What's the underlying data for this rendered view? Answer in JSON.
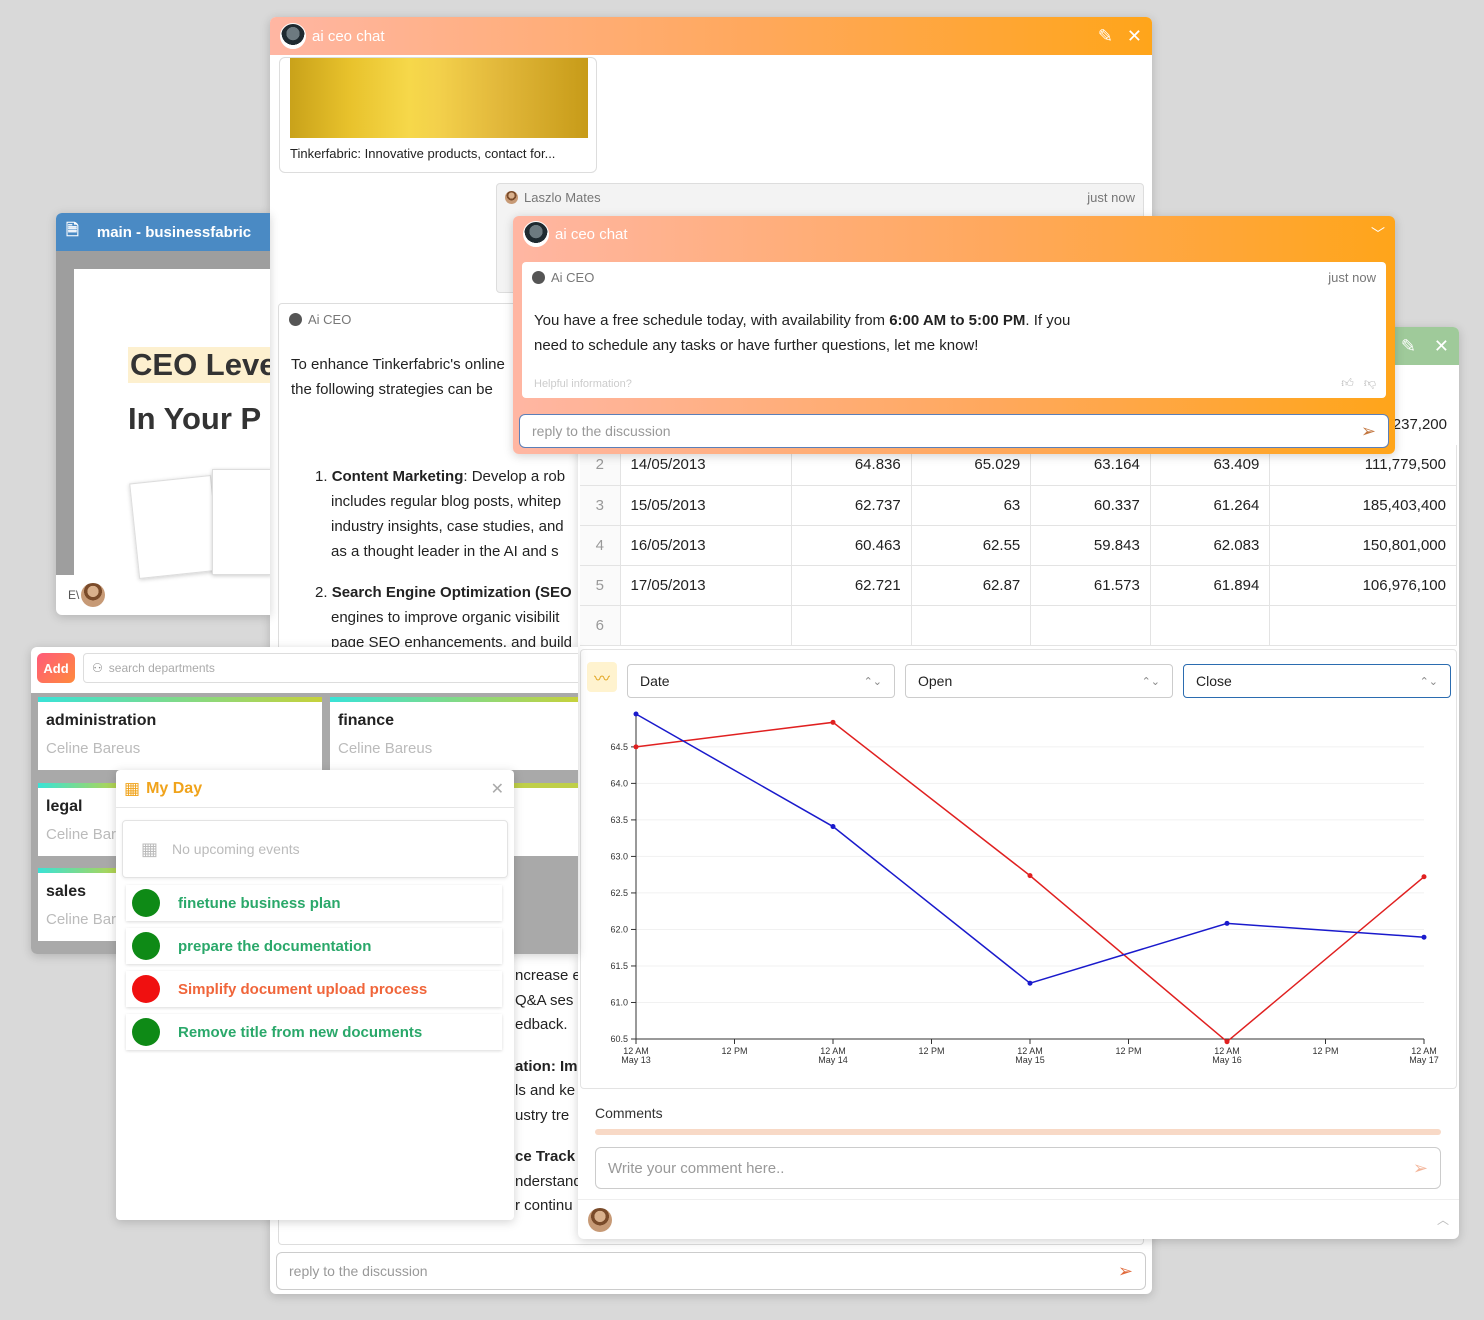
{
  "back_chat": {
    "title": "ai ceo chat",
    "link_preview": "Tinkerfabric: Innovative products, contact for...",
    "user_msg": {
      "author": "Laszlo Mates",
      "time": "just now"
    },
    "ai_msg": {
      "author": "Ai CEO",
      "intro": "To enhance Tinkerfabric's online",
      "intro2": "the following strategies can be",
      "item1_title": "Content Marketing",
      "item1_lines": [
        ": Develop a rob",
        "includes regular blog posts, whitep",
        "industry insights, case studies, and",
        "as a thought leader in the AI and s"
      ],
      "item2_title": "Search Engine Optimization (SEO",
      "item2_lines": [
        "engines to improve organic visibilit",
        "page SEO enhancements, and build"
      ],
      "frag": [
        "ncrease e",
        "Q&A ses",
        "edback.",
        "ation: Im",
        "ls and ke",
        "ustry tre",
        "ce Track",
        "nderstand",
        "r continu"
      ]
    },
    "reply_placeholder": "reply to the discussion"
  },
  "doc_window": {
    "title": "main - businessfabric",
    "heading1": "CEO Leve",
    "heading2": "In Your P",
    "footer_initials": "E\\"
  },
  "front_chat": {
    "title": "ai ceo chat",
    "msg": {
      "author": "Ai CEO",
      "time": "just now",
      "text_a": "You have a free schedule today, with availability from ",
      "text_bold": "6:00 AM to 5:00 PM",
      "text_b": ". If you",
      "text_c": "need to schedule any tasks or have further questions, let me know!",
      "helpful": "Helpful information?"
    },
    "reply_placeholder": "reply to the discussion"
  },
  "data_window": {
    "partial_value": "237,200",
    "rows": [
      {
        "n": "2",
        "date": "14/05/2013",
        "c1": "64.836",
        "c2": "65.029",
        "c3": "63.164",
        "c4": "63.409",
        "c5": "111,779,500"
      },
      {
        "n": "3",
        "date": "15/05/2013",
        "c1": "62.737",
        "c2": "63",
        "c3": "60.337",
        "c4": "61.264",
        "c5": "185,403,400"
      },
      {
        "n": "4",
        "date": "16/05/2013",
        "c1": "60.463",
        "c2": "62.55",
        "c3": "59.843",
        "c4": "62.083",
        "c5": "150,801,000"
      },
      {
        "n": "5",
        "date": "17/05/2013",
        "c1": "62.721",
        "c2": "62.87",
        "c3": "61.573",
        "c4": "61.894",
        "c5": "106,976,100"
      },
      {
        "n": "6",
        "date": "",
        "c1": "",
        "c2": "",
        "c3": "",
        "c4": "",
        "c5": ""
      }
    ],
    "selects": {
      "x": "Date",
      "y1": "Open",
      "y2": "Close"
    },
    "comments_label": "Comments",
    "comment_placeholder": "Write your comment here.."
  },
  "chart_data": {
    "type": "line",
    "x": [
      "12 AM May 13",
      "12 AM May 14",
      "12 AM May 15",
      "12 AM May 16",
      "12 AM May 17"
    ],
    "x_ticks": [
      "12 AM|May 13",
      "12 PM",
      "12 AM|May 14",
      "12 PM",
      "12 AM|May 15",
      "12 PM",
      "12 AM|May 16",
      "12 PM",
      "12 AM|May 17"
    ],
    "y_ticks": [
      "60.5",
      "61.0",
      "61.5",
      "62.0",
      "62.5",
      "63.0",
      "63.5",
      "64.0",
      "64.5"
    ],
    "ylim": [
      60.5,
      64.95
    ],
    "series": [
      {
        "values": [
          64.5,
          64.836,
          62.737,
          60.463,
          62.721
        ],
        "color": "#e02020"
      },
      {
        "values": [
          64.95,
          63.409,
          61.264,
          62.083,
          61.894
        ],
        "color": "#1a1acc"
      }
    ]
  },
  "departments": {
    "add_label": "Add",
    "search_placeholder": "search departments",
    "items": [
      {
        "name": "administration",
        "person": "Celine Bareus"
      },
      {
        "name": "finance",
        "person": "Celine Bareus"
      },
      {
        "name": "legal",
        "person": "Celine Bar"
      },
      {
        "name": "sales",
        "person": "Celine Bar"
      }
    ]
  },
  "my_day": {
    "title": "My Day",
    "empty": "No upcoming events",
    "tasks": [
      {
        "label": "finetune business plan",
        "status": "green"
      },
      {
        "label": "prepare the documentation",
        "status": "green"
      },
      {
        "label": "Simplify document upload process",
        "status": "red"
      },
      {
        "label": "Remove title from new documents",
        "status": "green"
      }
    ]
  },
  "colors": {
    "green": "#0e8a16",
    "red": "#f01010",
    "task_green": "#2aa86a",
    "task_red": "#f0653a",
    "accent": "#ffa51a"
  }
}
